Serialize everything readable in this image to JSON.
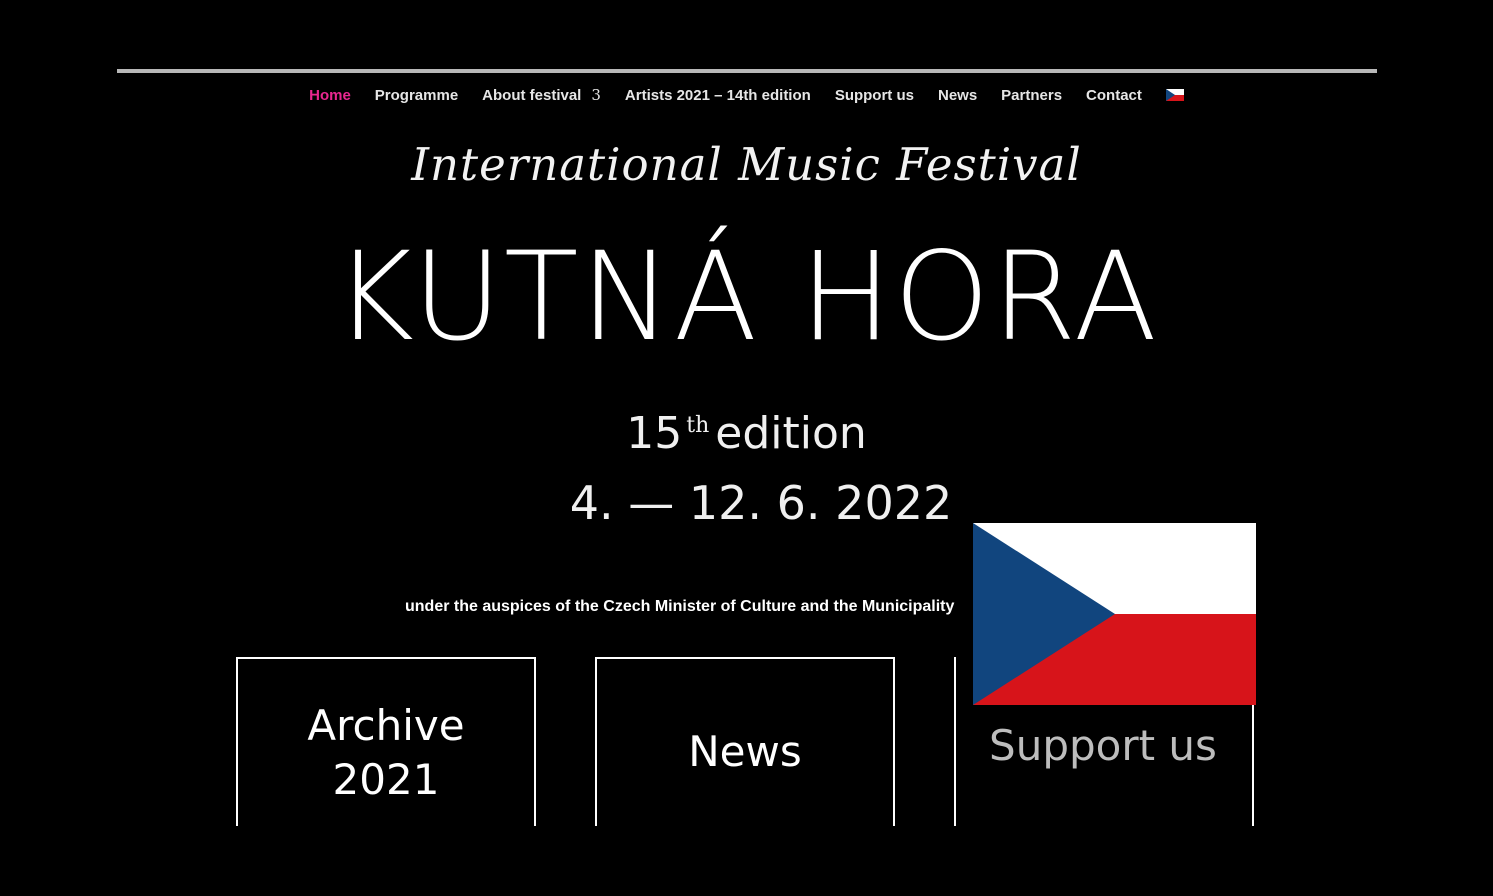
{
  "nav": {
    "items": [
      {
        "label": "Home",
        "active": true
      },
      {
        "label": "Programme"
      },
      {
        "label": "About festival",
        "chevron": "3"
      },
      {
        "label": "Artists 2021 – 14th edition"
      },
      {
        "label": "Support us"
      },
      {
        "label": "News"
      },
      {
        "label": "Partners"
      },
      {
        "label": "Contact"
      }
    ],
    "language_icon": "czech-flag-icon"
  },
  "hero": {
    "subtitle": "International Music Festival",
    "title": "KUTNÁ HORA",
    "edition_number": "15",
    "edition_suffix": "th",
    "edition_word": "edition",
    "dates": "4. — 12. 6. 2022",
    "auspices": "under the auspices of the Czech Minister of Culture and the Municipality of Kutná Hora"
  },
  "cards": [
    {
      "line1": "Archive",
      "line2": "2021"
    },
    {
      "line1": "News"
    },
    {
      "line1": "Support us"
    }
  ],
  "overlay_flag": "czech-flag-icon",
  "colors": {
    "background": "#000000",
    "accent": "#e8278f",
    "flag_blue": "#11457e",
    "flag_red": "#d7141a",
    "flag_white": "#ffffff"
  }
}
